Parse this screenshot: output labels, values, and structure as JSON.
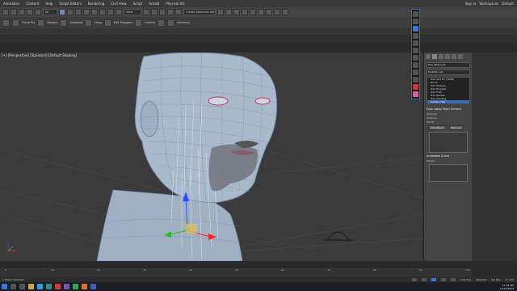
{
  "menu": {
    "items": [
      "Animation",
      "Content",
      "Help",
      "Graph Editors",
      "Rendering",
      "Civil View",
      "Script",
      "Arnold",
      "Physical XG"
    ],
    "right": [
      "Sign In",
      "Workspaces",
      "Default"
    ]
  },
  "toolbar": {
    "selection_filter": "All",
    "named_selection": "Create Selection Set",
    "view_dropdown": "View"
  },
  "ribbon": {
    "labels": [
      "Clone Pts",
      "Sample",
      "Optimize",
      "Drag",
      "Edit Polygons",
      "Outline",
      "Selection"
    ]
  },
  "viewport": {
    "label": "[+] [Perspective] [Standard] [Default Shading]"
  },
  "command_panel": {
    "object_name": "Hair_Beard_01",
    "modifier_list": "Modifier List",
    "stack": [
      "Hair and Fur (WSM)",
      "Brush",
      "Hair Strands",
      "Hair Ponytail",
      "Hair Frizz",
      "Hair Guides",
      "Hair Shading",
      "Surface Hair"
    ],
    "selected_index": 7,
    "rollout_title": "Push Away From Surface",
    "rollout_fields": [
      "Strength",
      "Distance",
      "Falloff"
    ],
    "buttons": [
      "Add Object",
      "Remove"
    ],
    "second_rollout": "Animated Curve",
    "second_field": "Weight"
  },
  "timeline": {
    "frames": [
      "0",
      "10",
      "20",
      "30",
      "40",
      "50",
      "60",
      "70",
      "80",
      "90",
      "100"
    ],
    "frame_counter": "0 / 100"
  },
  "status": {
    "message": "1 Object Selected",
    "auto_key": "Auto Key",
    "set_key": "Set Key",
    "selected": "Selected"
  },
  "taskbar": {
    "time": "11:38 AM",
    "date": "11/20/2023"
  },
  "colors": {
    "accent": "#2f7be0",
    "selection": "#3b6bb3",
    "background": "#2b2b2b"
  }
}
